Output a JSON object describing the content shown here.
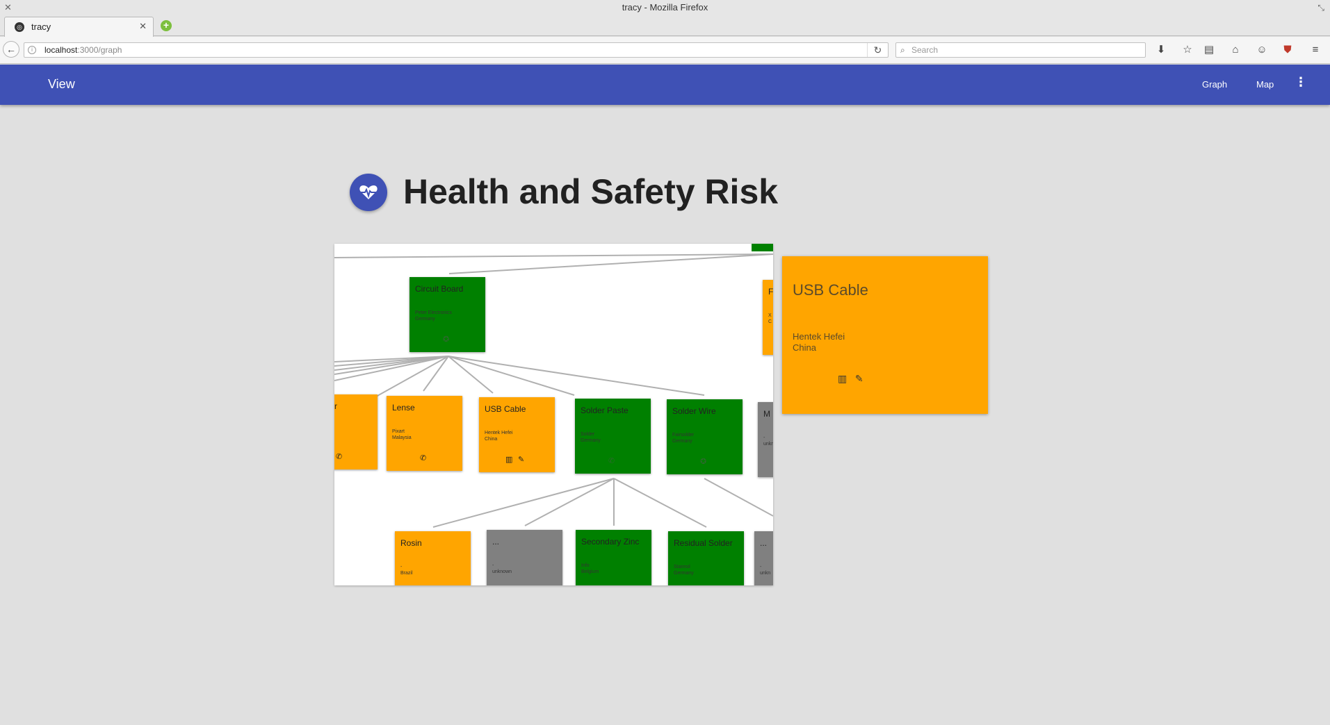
{
  "window": {
    "title": "tracy - Mozilla Firefox"
  },
  "tab": {
    "title": "tracy"
  },
  "url": {
    "host": "localhost",
    "path": ":3000/graph"
  },
  "search": {
    "placeholder": "Search"
  },
  "appbar": {
    "title": "View",
    "links": [
      "Graph",
      "Map"
    ]
  },
  "page": {
    "title": "Health and Safety Risk",
    "icon": "heart-pulse-icon"
  },
  "graph": {
    "nodes": [
      {
        "name": "Circuit Board",
        "supplier": [
          "Peter Electronics",
          "Germany"
        ],
        "color": "#008000",
        "icons": [
          "certificate-icon"
        ]
      },
      {
        "name": "r",
        "supplier": [],
        "color": "#ffa500",
        "icons": [
          "phone-icon"
        ]
      },
      {
        "name": "Lense",
        "supplier": [
          "Pixart",
          "Malaysia"
        ],
        "color": "#ffa500",
        "icons": [
          "phone-icon"
        ]
      },
      {
        "name": "USB Cable",
        "supplier": [
          "Hentek Hefei",
          "China"
        ],
        "color": "#ffa500",
        "icons": [
          "factory-icon",
          "chat-icon"
        ]
      },
      {
        "name": "Solder Paste",
        "supplier": [
          "Solder",
          "Germany"
        ],
        "color": "#008000",
        "icons": [
          "phone-icon"
        ]
      },
      {
        "name": "Solder Wire",
        "supplier": [
          "Fairsolder",
          "Germany"
        ],
        "color": "#008000",
        "icons": [
          "certificate-icon"
        ]
      },
      {
        "name": "M",
        "supplier": [
          "-",
          "unkn"
        ],
        "color": "#808080",
        "icons": []
      },
      {
        "name": "F",
        "supplier": [
          "X",
          "C"
        ],
        "color": "#ffa500",
        "icons": []
      },
      {
        "name": "Rosin",
        "supplier": [
          "-",
          "Brazil"
        ],
        "color": "#ffa500",
        "icons": []
      },
      {
        "name": "...",
        "supplier": [
          "-",
          "unknown"
        ],
        "color": "#808080",
        "icons": []
      },
      {
        "name": "Secondary Zinc",
        "supplier": [
          "Info",
          "Belgium"
        ],
        "color": "#008000",
        "icons": []
      },
      {
        "name": "Residual Solder",
        "supplier": [
          "Stannol",
          "Germany"
        ],
        "color": "#008000",
        "icons": []
      },
      {
        "name": "...",
        "supplier": [
          "-",
          "unkn"
        ],
        "color": "#808080",
        "icons": []
      }
    ]
  },
  "detail": {
    "name": "USB Cable",
    "supplier_name": "Hentek Hefei",
    "supplier_country": "China",
    "color": "#ffa500",
    "icons": [
      "factory-icon",
      "chat-icon"
    ]
  }
}
